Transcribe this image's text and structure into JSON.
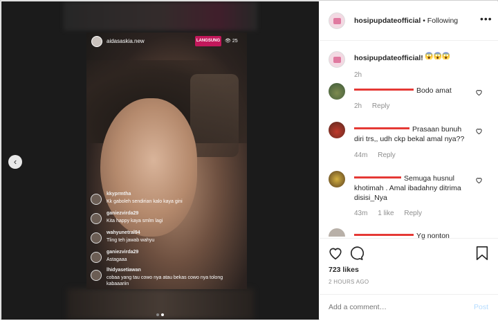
{
  "story": {
    "username": "aidasaskia.new",
    "live_badge": "LANGSUNG",
    "viewer_count": "25",
    "comments": [
      {
        "user": "kkyprmtha",
        "text": "Kk gaboleh sendirian kalo kaya gini"
      },
      {
        "user": "ganiezvirda29",
        "text": "Kita happy kaya smlm lagi"
      },
      {
        "user": "wahyunetral94",
        "text": "Tling teh jawab wahyu"
      },
      {
        "user": "ganiezvirda29",
        "text": "Astagaaa"
      },
      {
        "user": "lhidyasetiawan",
        "text": "cobaa yang tau cowo nya atau bekas cowo nya tolong kabaaariin"
      }
    ]
  },
  "post": {
    "header_user": "hosipupdateofficial",
    "follow_status": "• Following",
    "more_icon": "•••",
    "caption_user": "hosipupdateofficial!",
    "caption_emoji": "😱😱😱",
    "caption_time": "2h",
    "comments": [
      {
        "text": "Bodo amat",
        "time": "2h",
        "reply": "Reply",
        "likes": ""
      },
      {
        "text": "Prasaan bunuh diri trs,, udh ckp bekal amal nya??",
        "time": "44m",
        "reply": "Reply",
        "likes": ""
      },
      {
        "text": "Semuga husnul khotimah . Amal ibadahny ditrima disisi_Nya",
        "time": "43m",
        "reply": "Reply",
        "likes": "1 like"
      },
      {
        "text": "Yg nonton",
        "time": "",
        "reply": "",
        "likes": ""
      }
    ],
    "likes": "723 likes",
    "time_ago": "2 HOURS AGO",
    "add_comment_placeholder": "Add a comment…",
    "post_button": "Post"
  },
  "nav": {
    "prev_icon": "‹"
  },
  "colors": {
    "live": "#c2185b",
    "redaction": "#e53935",
    "post_button": "#b3dbff"
  }
}
